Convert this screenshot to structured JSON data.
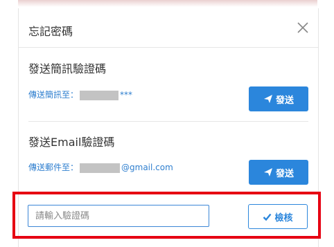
{
  "modal": {
    "title": "忘記密碼"
  },
  "sms": {
    "title": "發送簡訊驗證碼",
    "label_prefix": "傳送簡訊至：",
    "label_suffix": "***",
    "button_label": "發送"
  },
  "email": {
    "title": "發送Email驗證碼",
    "label_prefix": "傳送郵件至：",
    "label_suffix": "@gmail.com",
    "button_label": "發送"
  },
  "verify": {
    "input_placeholder": "請輸入驗證碼",
    "input_value": "",
    "button_label": "檢核"
  },
  "icons": {
    "close": "close-icon",
    "send": "paper-plane-icon",
    "check": "check-icon"
  },
  "colors": {
    "accent": "#2b86dc",
    "highlight": "#e60012"
  }
}
